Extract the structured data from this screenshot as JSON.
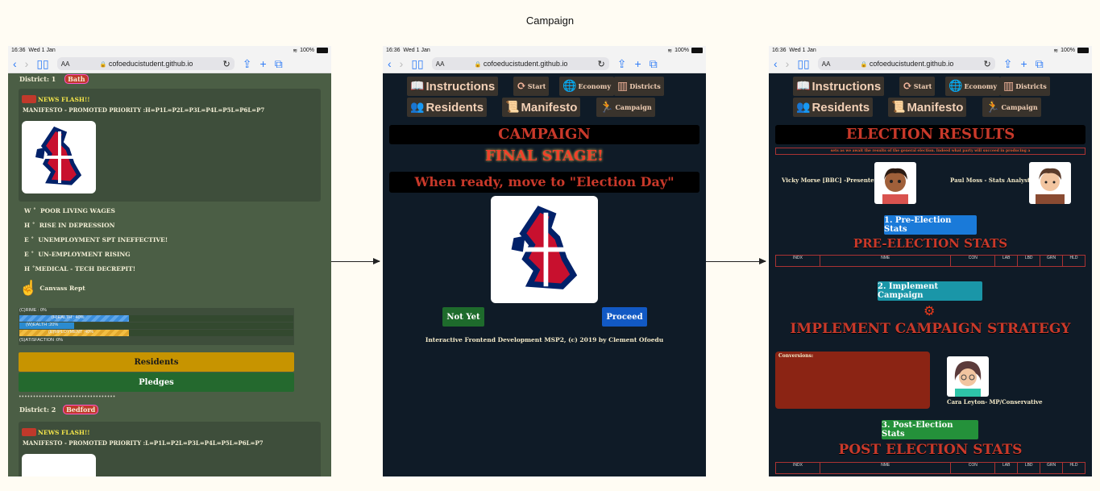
{
  "page_title": "Campaign",
  "browser": {
    "time": "16:36",
    "date": "Wed 1 Jan",
    "battery": "100%",
    "aa": "AA",
    "url": "cofoeducistudent.github.io"
  },
  "left": {
    "district1_label": "District:",
    "district1_num": "1",
    "district1_town": "Bath",
    "news1": "NEWS FLASH!!",
    "manifesto1": "MANIFESTO - PROMOTED PRIORITY :H=P1L=P2L=P3L=P4L=P5L=P6L=P7",
    "issues": [
      {
        "letter": "W",
        "text": "POOR LIVING WAGES"
      },
      {
        "letter": "H",
        "text": "RISE IN DEPRESSION"
      },
      {
        "letter": "E",
        "text": "UNEMPLOYMENT SPT INEFFECTIVE!"
      },
      {
        "letter": "E",
        "text": "UN-EMPLOYMENT RISING"
      },
      {
        "letter": "H",
        "text": "MEDICAL - TECH DECREPIT!"
      }
    ],
    "canvass": "Canvass Rept",
    "crime": "(C)RIME : 0%",
    "health": "(H)EALTH : 40%",
    "health_pct": 40,
    "wealth": "(W)EALTH :20%",
    "wealth_pct": 20,
    "employment": "(E)MPLOYMENT :40%",
    "employment_pct": 40,
    "satisfaction": "(S)ATISFACTION :0%",
    "residents_btn": "Residents",
    "pledges_btn": "Pledges",
    "dots": "••••••••••••••••••••••••••••••••••",
    "district2_label": "District:",
    "district2_num": "2",
    "district2_town": "Bedford",
    "news2": "NEWS FLASH!!",
    "manifesto2": "MANIFESTO - PROMOTED PRIORITY :L=P1L=P2L=P3L=P4L=P5L=P6L=P7"
  },
  "nav": {
    "instructions": "Instructions",
    "start": "Start",
    "economy": "Economy",
    "districts": "Districts",
    "residents": "Residents",
    "manifesto": "Manifesto",
    "campaign": "Campaign"
  },
  "middle": {
    "heading": "CAMPAIGN",
    "stage": "FINAL STAGE!",
    "ready": "When ready, move to \"Election Day\"",
    "not_yet": "Not Yet",
    "proceed": "Proceed",
    "footer": "Interactive Frontend Development MSP2, (c) 2019 by Clement Ofoedu"
  },
  "right": {
    "heading": "ELECTION RESULTS",
    "marquee": "sets as we await the results of the general election. Indeed what party will succeed in producing a",
    "presenter": "Vicky Morse [BBC] -Presenter",
    "analyst": "Paul Moss - Stats Analyst",
    "pre_btn": "1. Pre-Election Stats",
    "pre_heading": "PRE-ELECTION STATS",
    "columns": [
      "INDX",
      "NME",
      "CON",
      "LAB",
      "LBD",
      "GRN",
      "HLD"
    ],
    "impl_btn": "2. Implement Campaign",
    "impl_heading": "IMPLEMENT CAMPAIGN STRATEGY",
    "conversions": "Conversions:",
    "mp": "Cara Leyton- MP/Conservative",
    "post_btn": "3. Post-Election Stats",
    "post_heading": "POST ELECTION STATS"
  }
}
